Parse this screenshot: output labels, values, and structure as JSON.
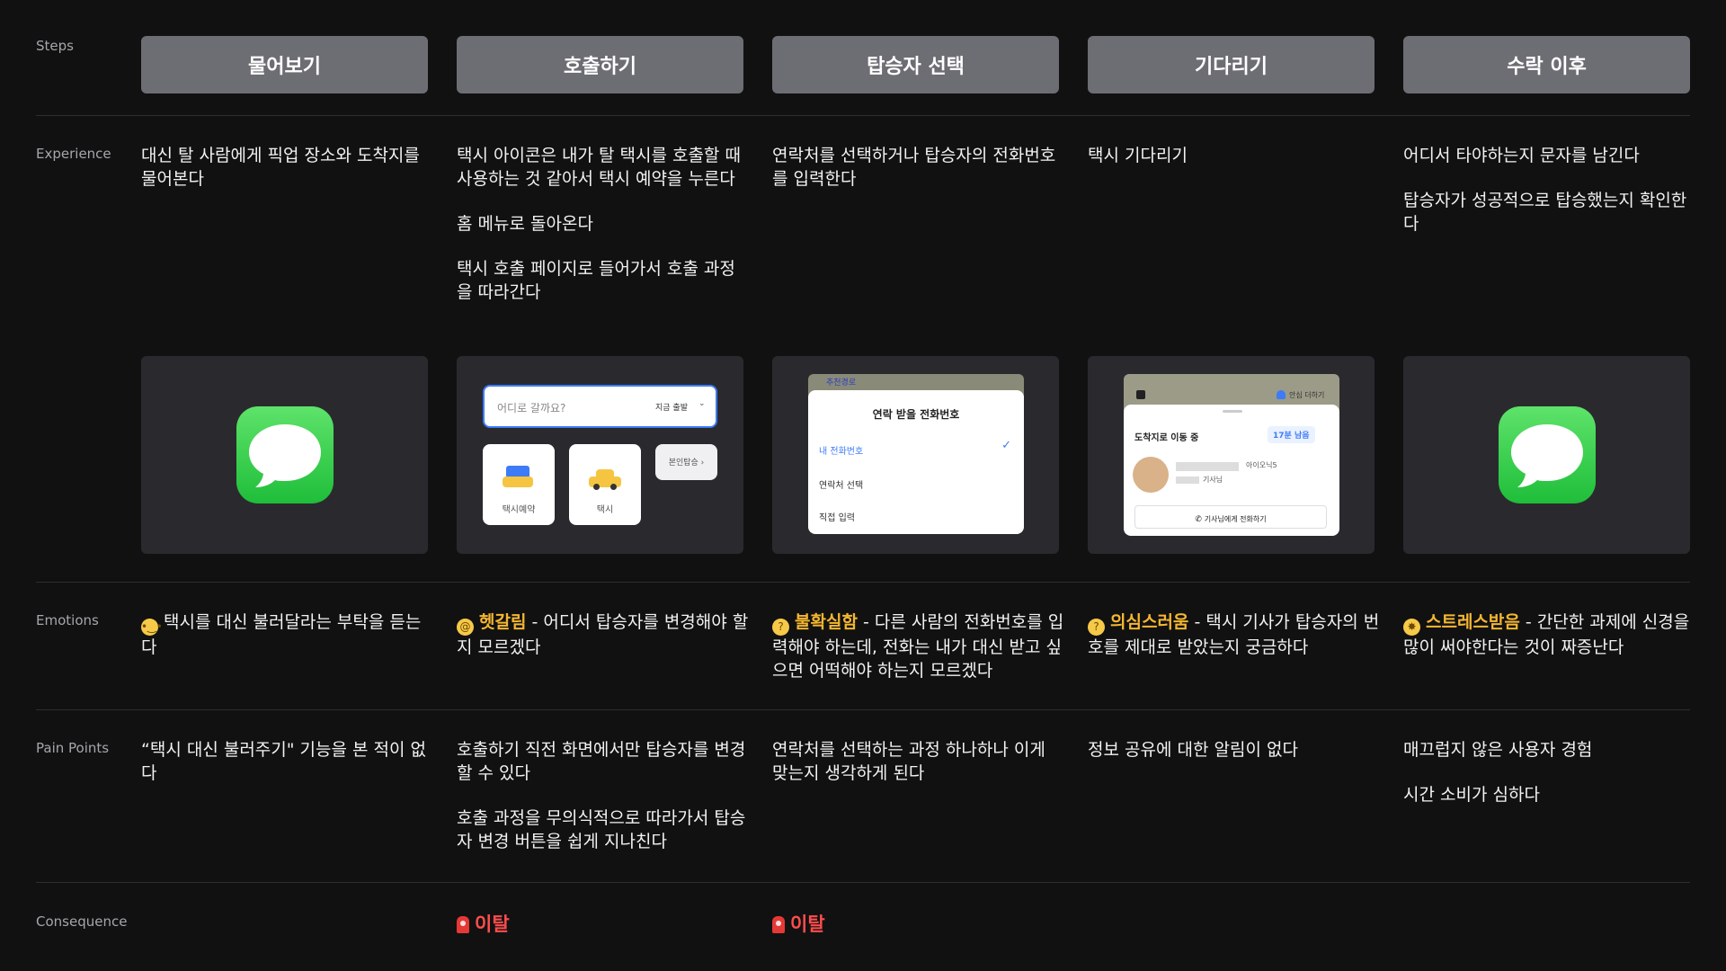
{
  "labels": {
    "steps": "Steps",
    "experience": "Experience",
    "emotions": "Emotions",
    "pain_points": "Pain Points",
    "consequence": "Consequence"
  },
  "steps": [
    "물어보기",
    "호출하기",
    "탑승자 선택",
    "기다리기",
    "수락 이후"
  ],
  "experience": [
    [
      "대신 탈 사람에게 픽업 장소와 도착지를 물어본다"
    ],
    [
      "택시 아이콘은 내가 탈 택시를 호출할 때 사용하는 것 같아서 택시 예약을 누른다",
      "홈 메뉴로 돌아온다",
      "택시 호출 페이지로 들어가서 호출 과정을 따라간다"
    ],
    [
      "연락처를 선택하거나 탑승자의 전화번호를 입력한다"
    ],
    [
      "택시 기다리기"
    ],
    [
      "어디서 타야하는지 문자를 남긴다",
      "탑승자가 성공적으로 탑승했는지 확인한다"
    ]
  ],
  "cards": {
    "call": {
      "search_placeholder": "어디로 갈까요?",
      "depart_now": "지금 출발",
      "tile_reserve": "택시예약",
      "tile_taxi": "택시",
      "self_ride": "본인탑승 ›"
    },
    "passenger": {
      "map_tag": "추천경로",
      "title": "연락 받을 전화번호",
      "options": [
        "내 전화번호",
        "연락처 선택",
        "직접 입력"
      ]
    },
    "wait": {
      "safe_btn": "안심 더하기",
      "status": "도착지로 이동 중",
      "remaining": "17분 남음",
      "car": "아이오닉5",
      "driver": "기사님",
      "call_driver": "기사님에게 전화하기"
    }
  },
  "emotions": [
    {
      "word": "",
      "text": "택시를 대신 불러달라는 부탁을 듣는다"
    },
    {
      "word": "헷갈림",
      "text": " - 어디서 탑승자를 변경해야 할 지 모르겠다"
    },
    {
      "word": "불확실함",
      "text": " - 다른 사람의 전화번호를 입력해야 하는데, 전화는 내가 대신 받고 싶으면 어떡해야 하는지 모르겠다"
    },
    {
      "word": "의심스러움",
      "text": " - 택시 기사가 탑승자의 번호를 제대로 받았는지 궁금하다"
    },
    {
      "word": "스트레스받음",
      "text": " - 간단한 과제에 신경을 많이 써야한다는 것이 짜증난다"
    }
  ],
  "pain_points": [
    [
      "“택시 대신 불러주기\" 기능을 본 적이 없다"
    ],
    [
      "호출하기 직전 화면에서만 탑승자를 변경할 수 있다",
      "호출 과정을 무의식적으로 따라가서 탑승자 변경 버튼을 쉽게 지나친다"
    ],
    [
      "연락처를 선택하는 과정 하나하나 이게 맞는지 생각하게 된다"
    ],
    [
      "정보 공유에 대한 알림이 없다"
    ],
    [
      "매끄럽지 않은 사용자 경험",
      "시간 소비가 심하다"
    ]
  ],
  "consequence": [
    "",
    "이탈",
    "이탈",
    "",
    ""
  ],
  "colors": {
    "background": "#111112",
    "step_box": "#6d6d74",
    "card": "#2a2a2e",
    "highlight": "#f5b731",
    "churn": "#ff4d4d",
    "imessage": "#2fcc4a"
  }
}
